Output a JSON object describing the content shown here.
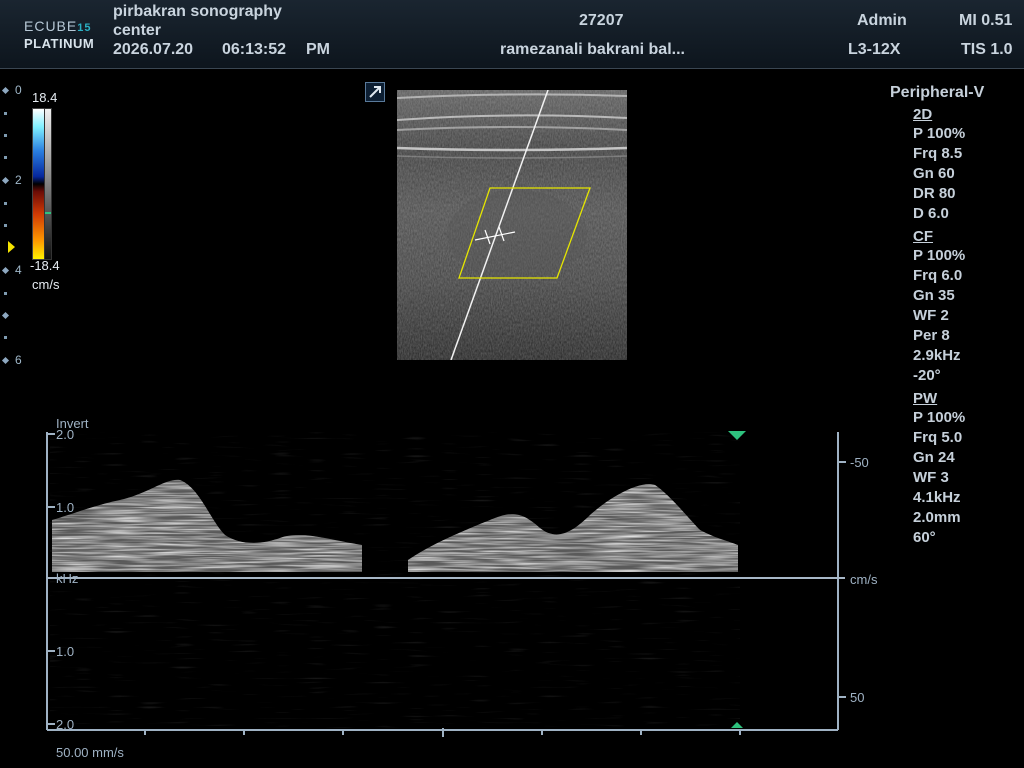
{
  "header": {
    "logo_top": "ECUBE",
    "logo_num": "15",
    "logo_bottom": "PLATINUM",
    "institution_line1": "pirbakran sonography",
    "institution_line2": "center",
    "date": "2026.07.20",
    "time": "06:13:52",
    "ampm": "PM",
    "patient_id": "27207",
    "patient_name": "ramezanali bakrani bal...",
    "user": "Admin",
    "probe": "L3-12X",
    "mi": "MI 0.51",
    "tis": "TIS 1.0"
  },
  "params": {
    "mode": "Peripheral-V",
    "sections": [
      {
        "title": "2D",
        "items": [
          "P 100%",
          "Frq 8.5",
          "Gn 60",
          "DR 80",
          "D 6.0"
        ]
      },
      {
        "title": "CF",
        "items": [
          "P 100%",
          "Frq 6.0",
          "Gn 35",
          "WF 2",
          "Per 8",
          "2.9kHz",
          "-20°"
        ]
      },
      {
        "title": "PW",
        "items": [
          "P 100%",
          "Frq 5.0",
          "Gn 24",
          "WF 3",
          "4.1kHz",
          "2.0mm",
          "60°"
        ]
      }
    ]
  },
  "depth_scale": [
    "0",
    "2",
    "4",
    "6"
  ],
  "color_scale": {
    "max": "18.4",
    "min": "-18.4",
    "unit": "cm/s"
  },
  "spectrum": {
    "invert_label": "Invert",
    "left_ticks": [
      "2.0",
      "1.0",
      "1.0",
      "2.0"
    ],
    "left_unit": "kHz",
    "right_ticks": [
      "-50",
      "50"
    ],
    "right_unit": "cm/s",
    "sweep_speed": "50.00 mm/s"
  },
  "colors": {
    "accent": "#2bb0c4",
    "marker_green": "#2ec27e",
    "gate_yellow": "#e6e600",
    "baseline": "#a8b8c8"
  }
}
